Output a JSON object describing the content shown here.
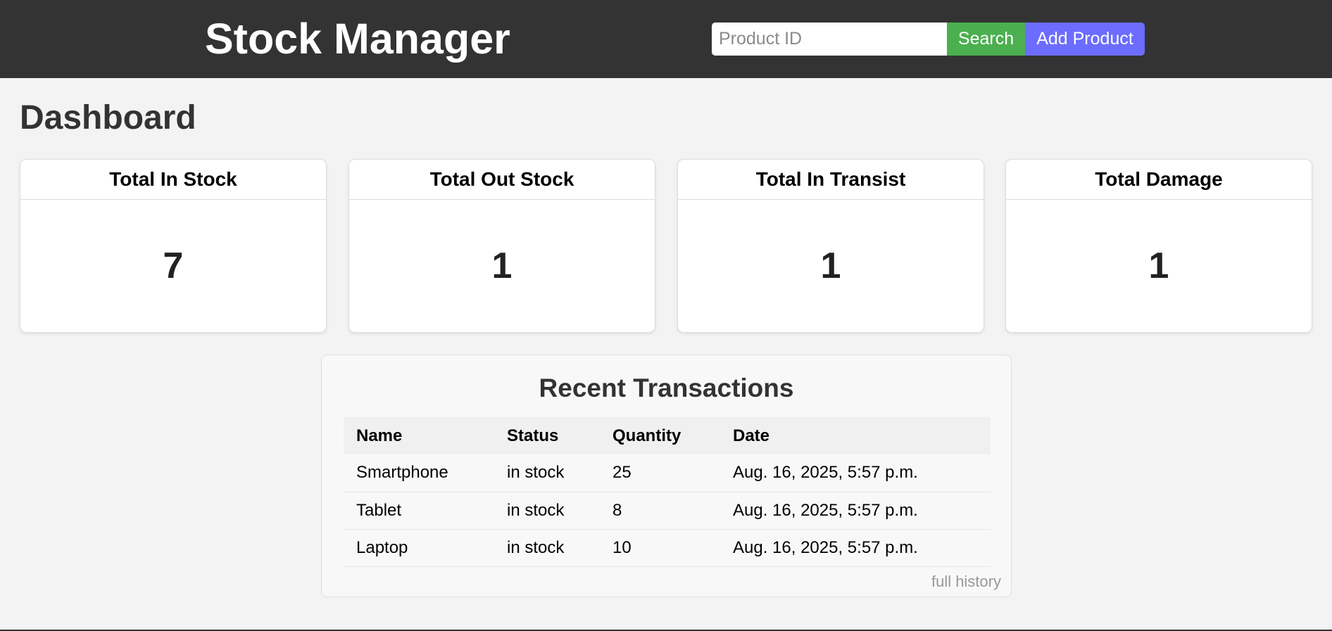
{
  "header": {
    "brand": "Stock Manager",
    "search_placeholder": "Product ID",
    "search_value": "",
    "search_button": "Search",
    "add_button": "Add Product"
  },
  "page": {
    "title": "Dashboard"
  },
  "stats": [
    {
      "label": "Total In Stock",
      "value": "7"
    },
    {
      "label": "Total Out Stock",
      "value": "1"
    },
    {
      "label": "Total In Transist",
      "value": "1"
    },
    {
      "label": "Total Damage",
      "value": "1"
    }
  ],
  "transactions": {
    "title": "Recent Transactions",
    "columns": [
      "Name",
      "Status",
      "Quantity",
      "Date"
    ],
    "rows": [
      {
        "name": "Smartphone",
        "status": "in stock",
        "quantity": "25",
        "date": "Aug. 16, 2025, 5:57 p.m."
      },
      {
        "name": "Tablet",
        "status": "in stock",
        "quantity": "8",
        "date": "Aug. 16, 2025, 5:57 p.m."
      },
      {
        "name": "Laptop",
        "status": "in stock",
        "quantity": "10",
        "date": "Aug. 16, 2025, 5:57 p.m."
      }
    ],
    "full_history_link": "full history"
  },
  "colors": {
    "header_bg": "#333333",
    "search_button": "#4caf50",
    "add_button": "#6c6cff",
    "page_bg": "#f3f3f3"
  }
}
